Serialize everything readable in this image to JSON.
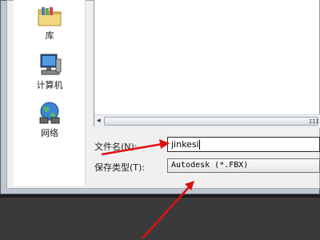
{
  "sidebar": {
    "items": [
      {
        "label": "库",
        "icon": "library-icon"
      },
      {
        "label": "计算机",
        "icon": "computer-icon"
      },
      {
        "label": "网络",
        "icon": "network-icon"
      }
    ]
  },
  "form": {
    "filename_label": "文件名(N):",
    "filename_value": "jinkesi",
    "savetype_label": "保存类型(T):",
    "savetype_value": "Autodesk (*.FBX)"
  },
  "colors": {
    "annotation_arrow": "#e01010",
    "background": "#3a3a3a"
  }
}
